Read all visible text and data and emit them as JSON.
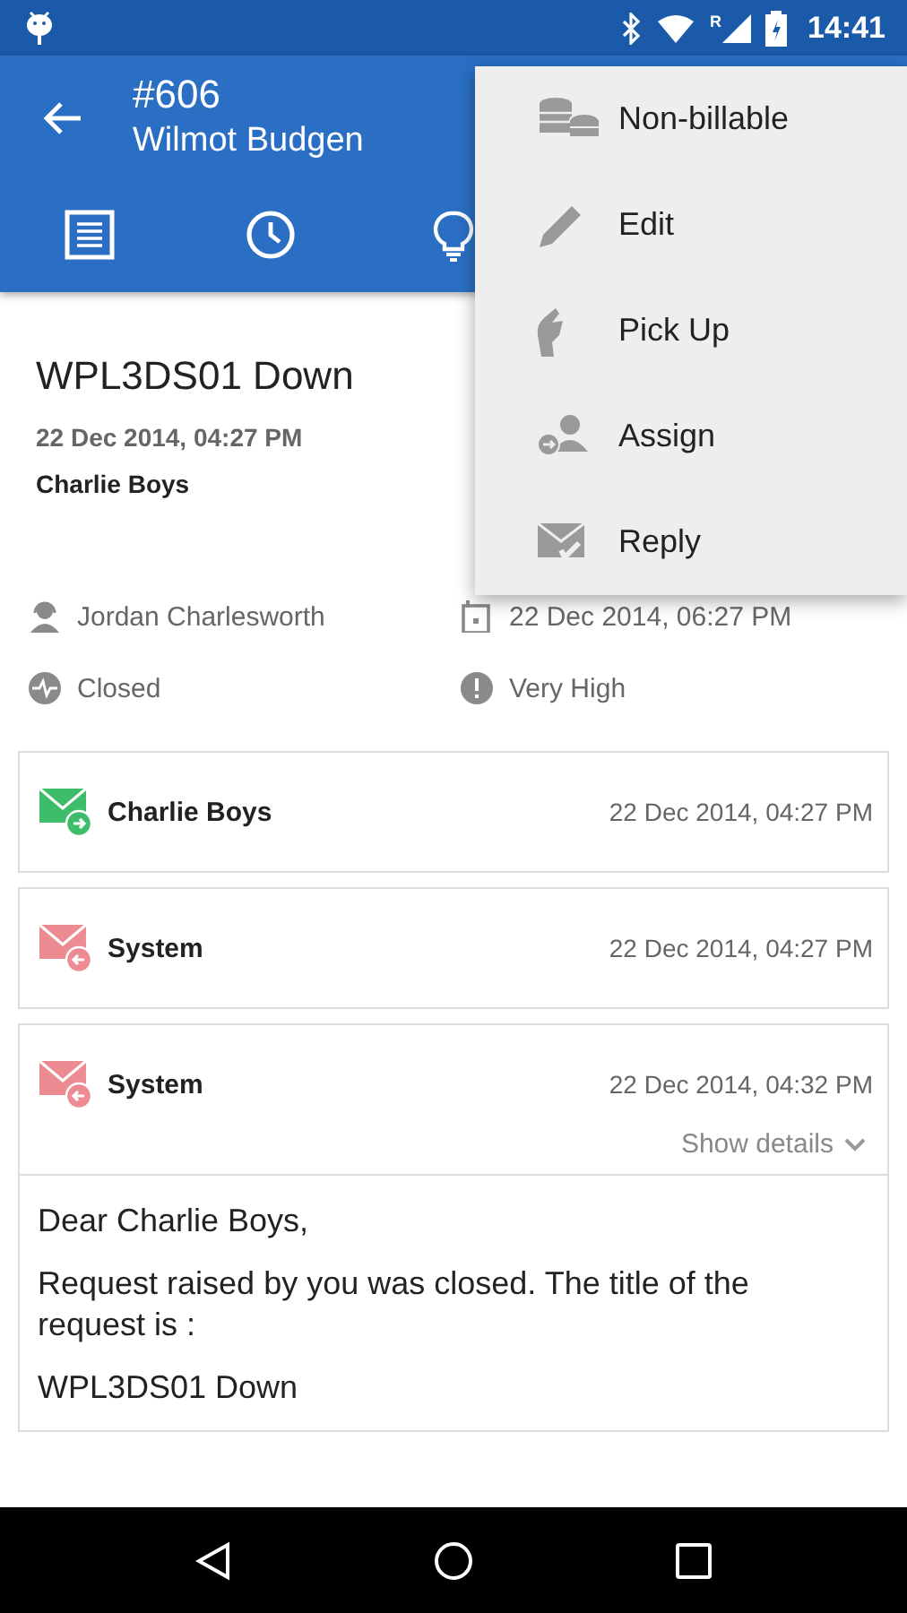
{
  "status_bar": {
    "time": "14:41",
    "network_label": "R"
  },
  "app_bar": {
    "number": "#606",
    "requester": "Wilmot Budgen"
  },
  "tabs": [
    {
      "kind": "details"
    },
    {
      "kind": "history"
    },
    {
      "kind": "solution"
    }
  ],
  "request": {
    "title": "WPL3DS01 Down",
    "created": "22 Dec 2014, 04:27 PM",
    "requested_by": "Charlie Boys"
  },
  "properties": [
    {
      "kind": "technician",
      "text": "Jordan Charlesworth"
    },
    {
      "kind": "due",
      "text": "22 Dec 2014, 06:27 PM"
    },
    {
      "kind": "status",
      "text": "Closed"
    },
    {
      "kind": "priority",
      "text": "Very High"
    }
  ],
  "conversations": [
    {
      "kind": "outgoing",
      "sender": "Charlie Boys",
      "time": "22 Dec 2014, 04:27 PM"
    },
    {
      "kind": "incoming",
      "sender": "System",
      "time": "22 Dec 2014, 04:27 PM"
    },
    {
      "kind": "incoming",
      "sender": "System",
      "time": "22 Dec 2014, 04:32 PM",
      "details_label": "Show details",
      "body": [
        "Dear Charlie Boys,",
        "Request raised by you was closed. The title of the request is :",
        "WPL3DS01 Down"
      ]
    }
  ],
  "menu": [
    {
      "kind": "coins",
      "label": "Non-billable"
    },
    {
      "kind": "pencil",
      "label": "Edit"
    },
    {
      "kind": "pickup",
      "label": "Pick Up"
    },
    {
      "kind": "assign",
      "label": "Assign"
    },
    {
      "kind": "reply",
      "label": "Reply"
    }
  ],
  "nav": [
    {
      "kind": "back"
    },
    {
      "kind": "home"
    },
    {
      "kind": "recents"
    }
  ]
}
